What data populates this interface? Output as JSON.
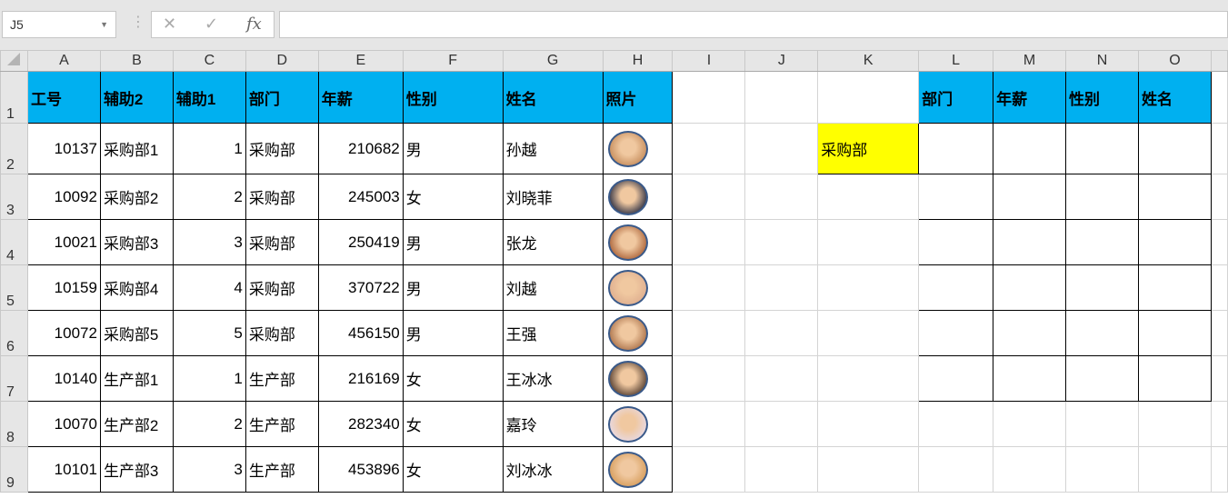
{
  "name_box": "J5",
  "formula_bar": {
    "cancel_icon": "✕",
    "enter_icon": "✓",
    "fx_label": "fx",
    "value": ""
  },
  "columns": [
    "A",
    "B",
    "C",
    "D",
    "E",
    "F",
    "G",
    "H",
    "I",
    "J",
    "K",
    "L",
    "M",
    "N",
    "O",
    ""
  ],
  "headers": [
    "工号",
    "辅助2",
    "辅助1",
    "部门",
    "年薪",
    "性别",
    "姓名",
    "照片",
    "",
    "",
    "",
    "部门",
    "年薪",
    "性别",
    "姓名"
  ],
  "rows": [
    {
      "num": "2",
      "cells": [
        "10137",
        "采购部1",
        "1",
        "采购部",
        "210682",
        "男",
        "孙越"
      ],
      "k": "采购部",
      "photo_color": "#c89060"
    },
    {
      "num": "3",
      "cells": [
        "10092",
        "采购部2",
        "2",
        "采购部",
        "245003",
        "女",
        "刘晓菲"
      ],
      "k": "",
      "photo_color": "#3a3a4a"
    },
    {
      "num": "4",
      "cells": [
        "10021",
        "采购部3",
        "3",
        "采购部",
        "250419",
        "男",
        "张龙"
      ],
      "k": "",
      "photo_color": "#b06a40"
    },
    {
      "num": "5",
      "cells": [
        "10159",
        "采购部4",
        "4",
        "采购部",
        "370722",
        "男",
        "刘越"
      ],
      "k": "",
      "photo_color": "#e0b090"
    },
    {
      "num": "6",
      "cells": [
        "10072",
        "采购部5",
        "5",
        "采购部",
        "456150",
        "男",
        "王强"
      ],
      "k": "",
      "photo_color": "#b07850"
    },
    {
      "num": "7",
      "cells": [
        "10140",
        "生产部1",
        "1",
        "生产部",
        "216169",
        "女",
        "王冰冰"
      ],
      "k": "",
      "photo_color": "#604838"
    },
    {
      "num": "8",
      "cells": [
        "10070",
        "生产部2",
        "2",
        "生产部",
        "282340",
        "女",
        "嘉玲"
      ],
      "k": "",
      "photo_color": "#e8d8e0"
    },
    {
      "num": "9",
      "cells": [
        "10101",
        "生产部3",
        "3",
        "生产部",
        "453896",
        "女",
        "刘冰冰"
      ],
      "k": "",
      "photo_color": "#d8a060"
    }
  ],
  "row1_num": "1",
  "colors": {
    "header_fill": "#00b0f0",
    "criteria_fill": "#ffff00"
  }
}
